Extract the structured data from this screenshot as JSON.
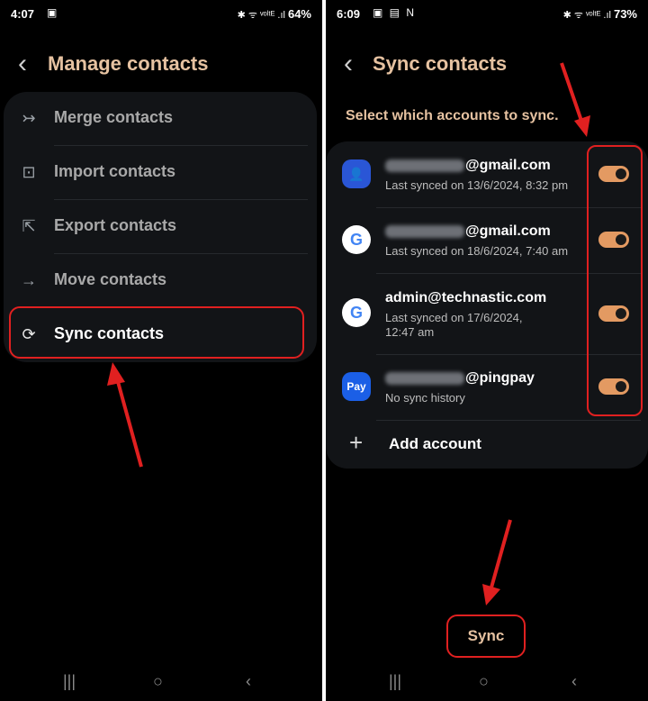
{
  "left": {
    "status": {
      "time": "4:07",
      "left_icons": "▣",
      "right_icons": "✱ ᯤ ᵛᵒˡᵗᴱ .ıl",
      "battery": "64%"
    },
    "title": "Manage contacts",
    "menu": [
      {
        "label": "Merge contacts",
        "icon": "↣"
      },
      {
        "label": "Import contacts",
        "icon": "⊡"
      },
      {
        "label": "Export contacts",
        "icon": "⇱"
      },
      {
        "label": "Move contacts",
        "icon": "→"
      },
      {
        "label": "Sync contacts",
        "icon": "⟳"
      }
    ],
    "nav": {
      "recents": "|||",
      "home": "○",
      "back": "‹"
    }
  },
  "right": {
    "status": {
      "time": "6:09",
      "left_icons": "▣ ▤ N",
      "right_icons": "✱ ᯤ ᵛᵒˡᵗᴱ .ıl",
      "battery": "73%"
    },
    "title": "Sync contacts",
    "subtitle": "Select which accounts to sync.",
    "accounts": [
      {
        "icon": "contacts-icon",
        "name": "@gmail.com",
        "blurred_prefix": true,
        "detail": "Last synced on 13/6/2024, 8:32 pm",
        "synced": true
      },
      {
        "icon": "google-icon",
        "name": "@gmail.com",
        "blurred_prefix": true,
        "detail": "Last synced on 18/6/2024, 7:40 am",
        "synced": true
      },
      {
        "icon": "google-icon",
        "name": "admin@technastic.com",
        "blurred_prefix": false,
        "detail": "Last synced on 17/6/2024, 12:47 am",
        "synced": true
      },
      {
        "icon": "samsung-pay-icon",
        "icon_text": "Pay",
        "name": "@pingpay",
        "blurred_prefix": true,
        "detail": "No sync history",
        "synced": true
      }
    ],
    "google_glyph": "G",
    "contacts_glyph": "👤",
    "add_account": "Add account",
    "sync_button": "Sync",
    "nav": {
      "recents": "|||",
      "home": "○",
      "back": "‹"
    }
  },
  "colors": {
    "accent": "#e6c2a1",
    "toggle": "#e39a62",
    "highlight": "#e02020",
    "card": "#121417"
  }
}
